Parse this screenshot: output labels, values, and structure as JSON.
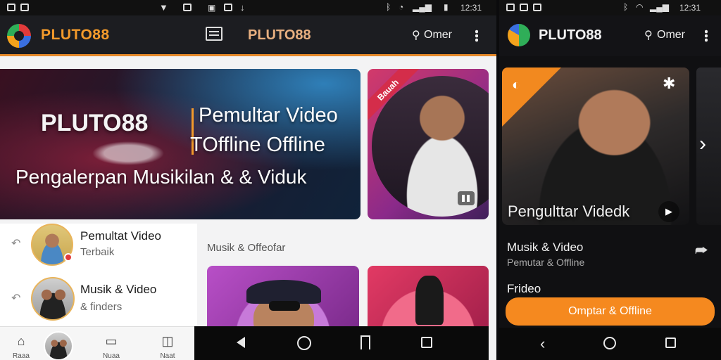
{
  "left_app": {
    "status_bar": {
      "time": "12:31"
    },
    "toolbar": {
      "brand": "PLUTO88",
      "center_brand": "PLUTO88",
      "search_label": "Omer"
    },
    "hero": {
      "title": "PLUTO88",
      "line1": "Pemultar Video",
      "line2": "TOffline Offline",
      "subtitle": "Pengalerpan Musikilan & & Viduk"
    },
    "side_card": {
      "ribbon": "Bauah"
    },
    "list": [
      {
        "title": "Pemultat Video",
        "subtitle": "Terbaik"
      },
      {
        "title": "Musik & Video",
        "subtitle": "& finders"
      }
    ],
    "section_label": "Musik & Offeofar",
    "bottom_nav": [
      {
        "label": "Raaa",
        "icon": "home-icon"
      },
      {
        "label": "",
        "icon": "avatar"
      },
      {
        "label": "Nuaa",
        "icon": "screen-icon"
      },
      {
        "label": "Naat",
        "icon": "bag-icon"
      }
    ]
  },
  "right_app": {
    "status_bar": {
      "time": "12:31"
    },
    "toolbar": {
      "brand": "PLUTO88",
      "search_label": "Omer"
    },
    "hero": {
      "title": "Pengulttar Videdk"
    },
    "item": {
      "title": "Musik & Video",
      "subtitle": "Pemutar & Offline"
    },
    "section": "Frideo",
    "cta": "Omptar & Offline"
  },
  "colors": {
    "accent": "#f39a2b",
    "cta": "#f5891f",
    "toolbar": "#1c1d21"
  }
}
